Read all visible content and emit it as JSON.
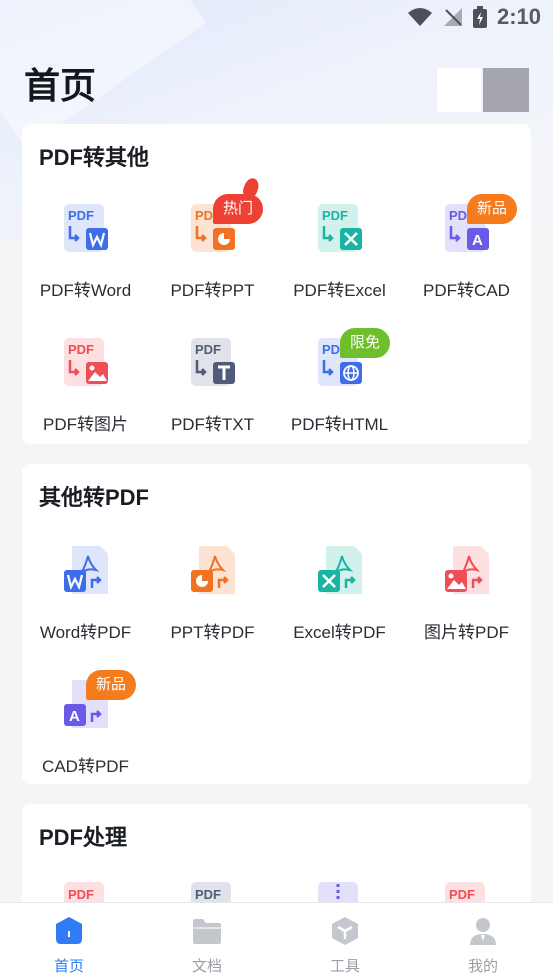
{
  "status_bar": {
    "time": "2:10"
  },
  "header": {
    "title": "首页"
  },
  "sections": [
    {
      "title": "PDF转其他",
      "items": [
        {
          "label": "PDF转Word",
          "icon": "pdf-to-word-icon"
        },
        {
          "label": "PDF转PPT",
          "icon": "pdf-to-ppt-icon",
          "badge": "热门"
        },
        {
          "label": "PDF转Excel",
          "icon": "pdf-to-excel-icon"
        },
        {
          "label": "PDF转CAD",
          "icon": "pdf-to-cad-icon",
          "badge": "新品"
        },
        {
          "label": "PDF转图片",
          "icon": "pdf-to-image-icon"
        },
        {
          "label": "PDF转TXT",
          "icon": "pdf-to-txt-icon"
        },
        {
          "label": "PDF转HTML",
          "icon": "pdf-to-html-icon",
          "badge": "限免"
        }
      ]
    },
    {
      "title": "其他转PDF",
      "items": [
        {
          "label": "Word转PDF",
          "icon": "word-to-pdf-icon"
        },
        {
          "label": "PPT转PDF",
          "icon": "ppt-to-pdf-icon"
        },
        {
          "label": "Excel转PDF",
          "icon": "excel-to-pdf-icon"
        },
        {
          "label": "图片转PDF",
          "icon": "image-to-pdf-icon"
        },
        {
          "label": "CAD转PDF",
          "icon": "cad-to-pdf-icon",
          "badge": "新品"
        }
      ]
    },
    {
      "title": "PDF处理",
      "icon_text": "PDF"
    }
  ],
  "tab_bar": {
    "tabs": [
      {
        "label": "首页",
        "icon": "home-icon",
        "active": true
      },
      {
        "label": "文档",
        "icon": "folder-icon"
      },
      {
        "label": "工具",
        "icon": "tools-icon"
      },
      {
        "label": "我的",
        "icon": "profile-icon"
      }
    ]
  },
  "colors": {
    "accent": "#2f7cf6",
    "word": "#3d6ee8",
    "ppt": "#f07222",
    "excel": "#19b5a2",
    "cad": "#6a5be6",
    "image": "#ef4e54",
    "txt": "#515a78",
    "hot_badge": "#ef4034",
    "new_badge": "#f57b1c",
    "free_badge": "#6fbe2c"
  }
}
